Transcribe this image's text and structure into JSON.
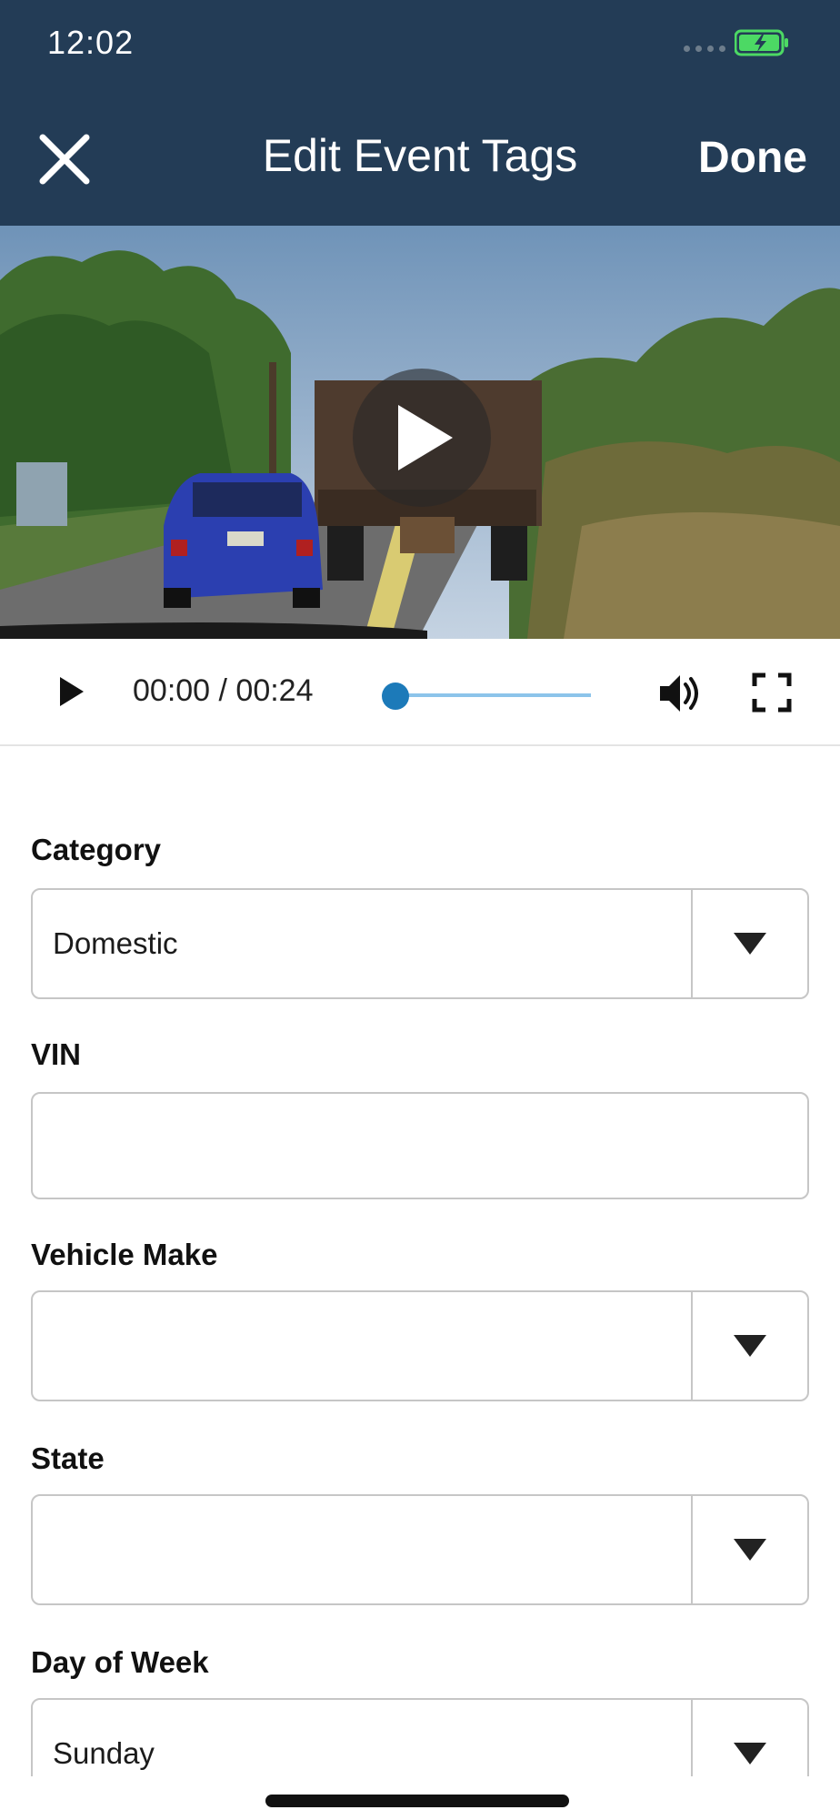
{
  "status_bar": {
    "time": "12:02"
  },
  "nav": {
    "title": "Edit Event Tags",
    "done_label": "Done"
  },
  "player": {
    "time_display": "00:00 / 00:24",
    "progress": 0.0
  },
  "form": {
    "category": {
      "label": "Category",
      "value": "Domestic"
    },
    "vin": {
      "label": "VIN",
      "value": ""
    },
    "vehicle_make": {
      "label": "Vehicle Make",
      "value": ""
    },
    "state": {
      "label": "State",
      "value": ""
    },
    "day_of_week": {
      "label": "Day of Week",
      "value": "Sunday"
    }
  },
  "colors": {
    "header_bg": "#233c56",
    "accent": "#1c7ab9",
    "battery": "#4cd964"
  }
}
